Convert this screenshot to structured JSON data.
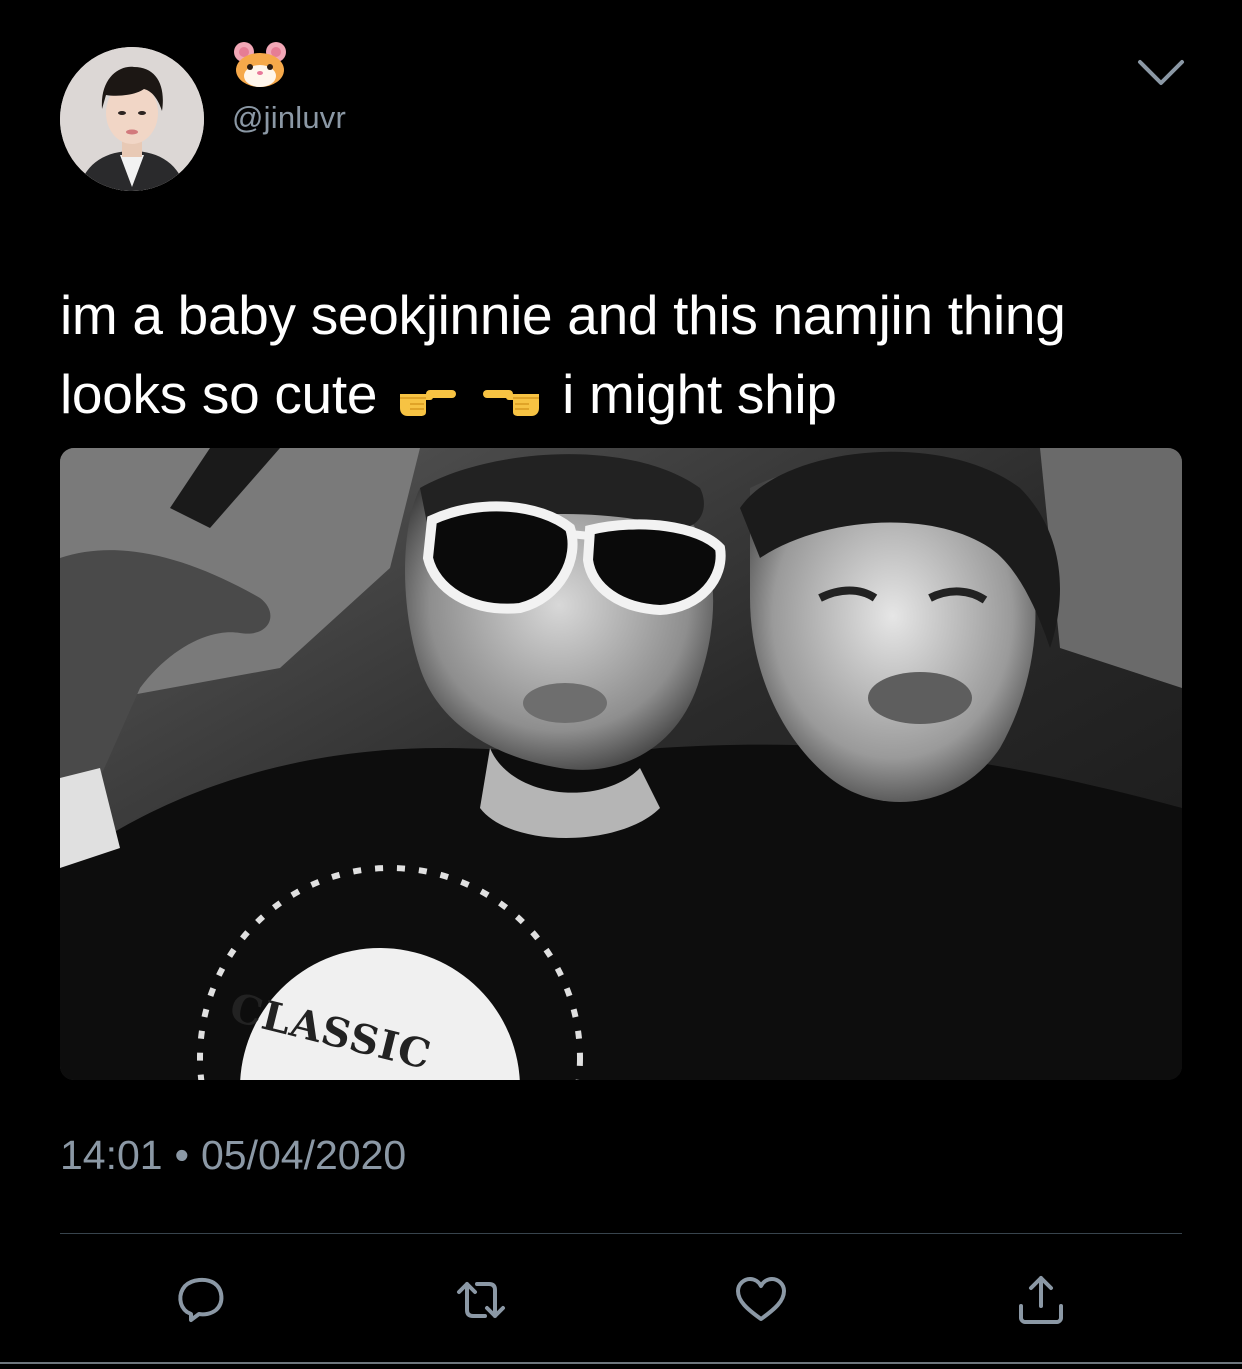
{
  "tweet": {
    "display_name_icon": "hamster-face-emoji",
    "handle": "@jinluvr",
    "text_part1": "im a baby seokjinnie and this namjin thing looks so cute",
    "emoji_1": "backhand-index-pointing-right-emoji",
    "emoji_2": "backhand-index-pointing-left-emoji",
    "text_part2": "i might ship",
    "time": "14:01",
    "separator": "•",
    "date": "05/04/2020",
    "image_caption_text": "CLASSIC"
  },
  "actions": {
    "reply_icon": "reply-icon",
    "retweet_icon": "retweet-icon",
    "like_icon": "heart-icon",
    "share_icon": "share-icon",
    "menu_icon": "chevron-down-icon"
  },
  "colors": {
    "background": "#000000",
    "text": "#ffffff",
    "secondary_text": "#8b98a5",
    "divider": "#38444d"
  }
}
